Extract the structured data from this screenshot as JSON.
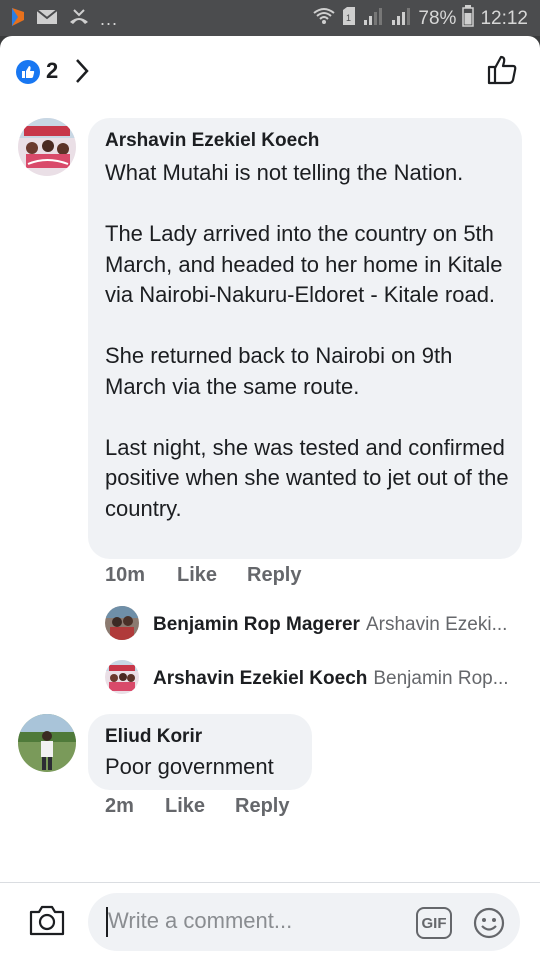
{
  "status_bar": {
    "dots": "...",
    "battery": "78%",
    "time": "12:12"
  },
  "header": {
    "reaction_count": "2"
  },
  "comments": [
    {
      "author": "Arshavin Ezekiel Koech",
      "text": "What Mutahi is not telling the Nation.\n\nThe Lady arrived into the country on 5th March, and headed to her home in Kitale via Nairobi-Nakuru-Eldoret - Kitale road.\n\nShe returned back to Nairobi on 9th March via the same route.\n\nLast night, she was tested and confirmed positive when she wanted to jet out of the country.",
      "time": "10m",
      "like": "Like",
      "reply": "Reply",
      "replies": [
        {
          "author": "Benjamin Rop Magerer",
          "preview": "Arshavin Ezeki..."
        },
        {
          "author": "Arshavin Ezekiel Koech",
          "preview": "Benjamin Rop..."
        }
      ]
    },
    {
      "author": "Eliud Korir",
      "text": "Poor government",
      "time": "2m",
      "like": "Like",
      "reply": "Reply"
    }
  ],
  "composer": {
    "placeholder": "Write a comment...",
    "gif_label": "GIF"
  },
  "colors": {
    "facebook_blue": "#1877f2",
    "bubble_bg": "#f0f2f5",
    "secondary_text": "#65676b"
  }
}
